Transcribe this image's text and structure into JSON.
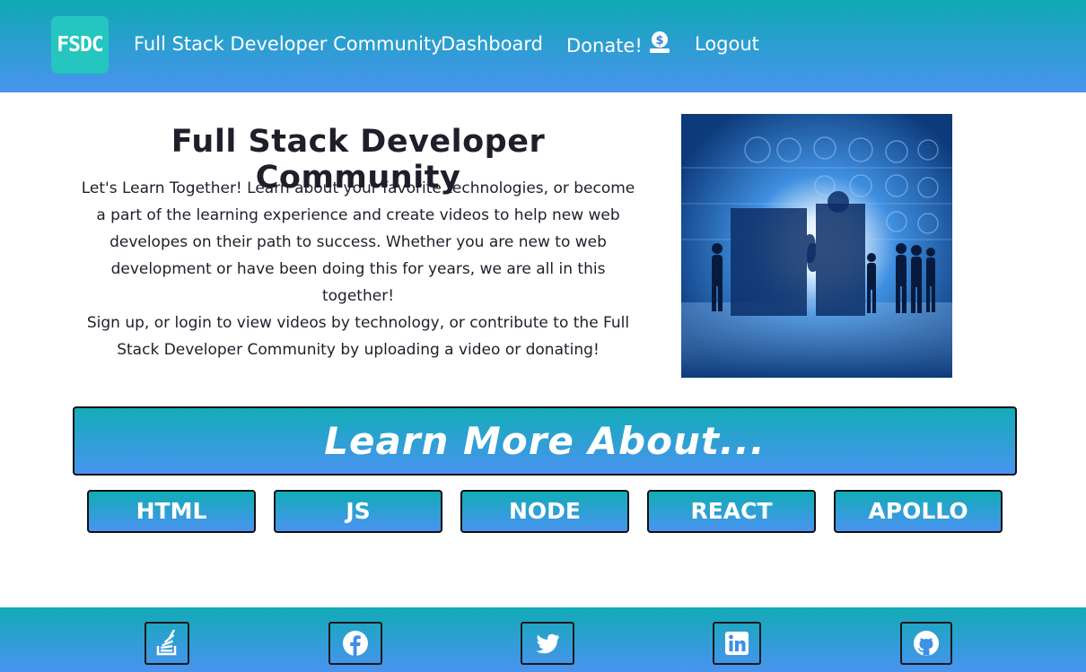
{
  "nav": {
    "logo_text": "FSDC",
    "links": [
      {
        "label": "Full Stack Developer Community"
      },
      {
        "label": "Dashboard"
      },
      {
        "label": "Donate!",
        "icon": "money-bill-icon"
      },
      {
        "label": "Logout"
      }
    ]
  },
  "hero": {
    "title": "Full Stack Developer Community",
    "paragraph1": "Let's Learn Together! Learn about your favorite technologies, or become a part of the learning experience and create videos to help new web developes on their path to success. Whether you are new to web development or have been doing this for years, we are all in this together!",
    "paragraph2": "Sign up, or login to view videos by technology, or contribute to the Full Stack Developer Community by uploading a video or donating!",
    "image": "puzzle-teamwork-image"
  },
  "learn": {
    "banner": "Learn More About...",
    "topics": [
      {
        "label": "HTML"
      },
      {
        "label": "JS"
      },
      {
        "label": "NODE"
      },
      {
        "label": "REACT"
      },
      {
        "label": "APOLLO"
      }
    ]
  },
  "footer": {
    "social": [
      {
        "icon": "stack-overflow-icon"
      },
      {
        "icon": "facebook-icon"
      },
      {
        "icon": "twitter-icon"
      },
      {
        "icon": "linkedin-icon"
      },
      {
        "icon": "github-icon"
      }
    ]
  },
  "colors": {
    "gradient_top": "#0fa9b3",
    "gradient_bottom": "#4a93f0",
    "logo_bg": "#25c5c0",
    "text": "#1f1f2b"
  }
}
